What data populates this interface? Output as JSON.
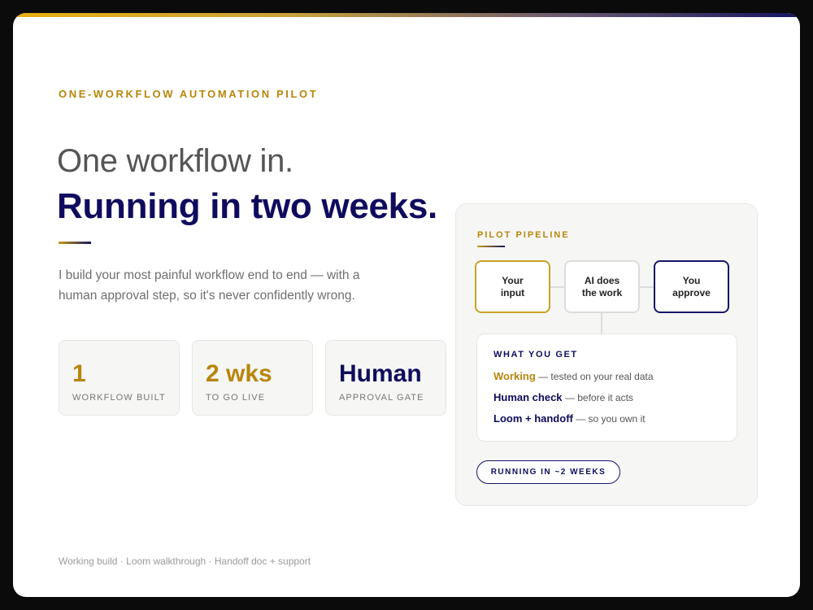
{
  "eyebrow": "ONE-WORKFLOW AUTOMATION PILOT",
  "headline": {
    "line1": "One workflow in.",
    "line2": "Running in two weeks."
  },
  "lede": "I build your most painful workflow end to end — with a human approval step, so it's never confidently wrong.",
  "stats": [
    {
      "value": "1",
      "label": "WORKFLOW BUILT"
    },
    {
      "value": "2 wks",
      "label": "TO GO LIVE"
    },
    {
      "value": "Human",
      "label": "APPROVAL GATE"
    }
  ],
  "pipeline": {
    "title": "PILOT PIPELINE",
    "nodes": [
      {
        "line1": "Your",
        "line2": "input"
      },
      {
        "line1": "AI does",
        "line2": "the work"
      },
      {
        "line1": "You",
        "line2": "approve"
      }
    ],
    "get": {
      "title": "WHAT YOU GET",
      "items": [
        {
          "term": "Working",
          "desc": " — tested on your real data"
        },
        {
          "term": "Human check",
          "desc": " — before it acts"
        },
        {
          "term": "Loom + handoff",
          "desc": " — so you own it"
        }
      ]
    },
    "badge": "RUNNING IN ~2 WEEKS"
  },
  "footer": "Working build · Loom walkthrough · Handoff doc + support",
  "colors": {
    "accent_gold": "#b8860b",
    "accent_navy": "#0f0c5e",
    "frame": "#0b0b0b",
    "panel_bg": "#f6f6f5"
  }
}
